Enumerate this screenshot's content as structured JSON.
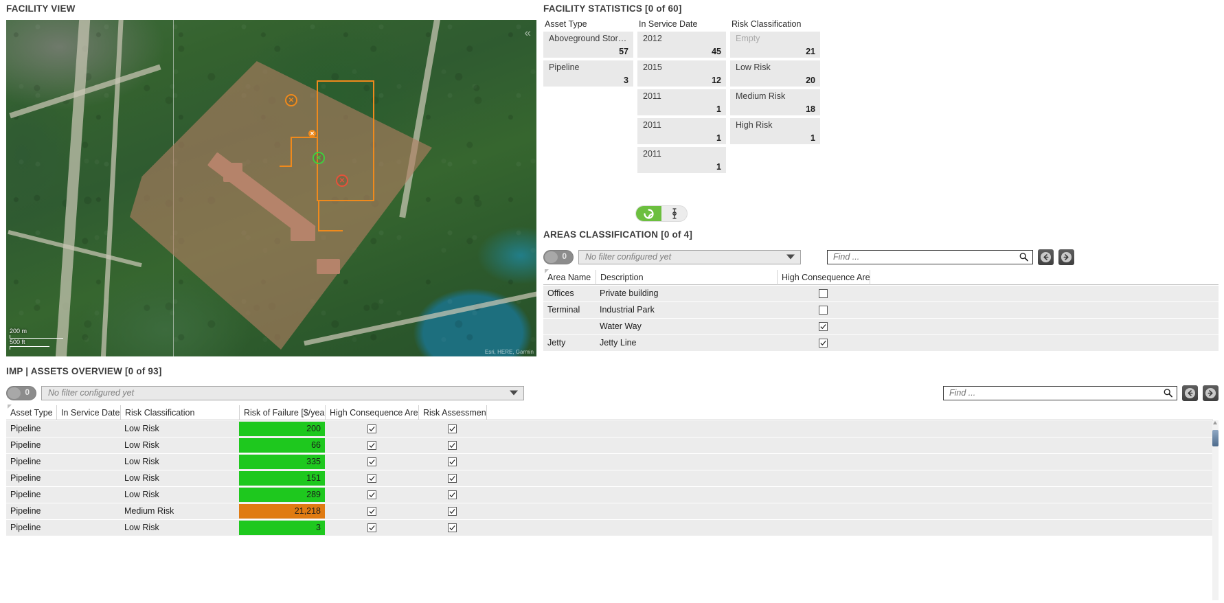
{
  "facility_view": {
    "title": "FACILITY VIEW",
    "collapse_icon": "chevron-left-icon",
    "scale_metric": "200 m",
    "scale_imperial": "500 ft",
    "attribution": "Esri, HERE, Garmin"
  },
  "facility_statistics": {
    "title": "FACILITY STATISTICS [0 of 60]",
    "columns": [
      {
        "header": "Asset Type",
        "cards": [
          {
            "label": "Aboveground Storage...",
            "value": "57",
            "empty": false
          },
          {
            "label": "Pipeline",
            "value": "3",
            "empty": false
          }
        ]
      },
      {
        "header": "In Service Date",
        "cards": [
          {
            "label": "2012",
            "value": "45",
            "empty": false
          },
          {
            "label": "2015",
            "value": "12",
            "empty": false
          },
          {
            "label": "2011",
            "value": "1",
            "empty": false
          },
          {
            "label": "2011",
            "value": "1",
            "empty": false
          },
          {
            "label": "2011",
            "value": "1",
            "empty": false
          }
        ]
      },
      {
        "header": "Risk Classification",
        "cards": [
          {
            "label": "Empty",
            "value": "21",
            "empty": true
          },
          {
            "label": "Low Risk",
            "value": "20",
            "empty": false
          },
          {
            "label": "Medium Risk",
            "value": "18",
            "empty": false
          },
          {
            "label": "High Risk",
            "value": "1",
            "empty": false
          }
        ]
      }
    ],
    "toggle": {
      "left_icon": "refresh-icon",
      "right_icon": "axis-stem-icon",
      "active_color": "#6cbf3f"
    }
  },
  "areas_classification": {
    "title": "AREAS CLASSIFICATION [0 of 4]",
    "toggle_value": "0",
    "filter_placeholder": "No filter configured yet",
    "find_placeholder": "Find ...",
    "find_value": "",
    "nav_back_icon": "arrow-left-circle-icon",
    "nav_forward_icon": "arrow-right-circle-icon",
    "columns": [
      "Area Name",
      "Description",
      "High Consequence Area",
      ""
    ],
    "rows": [
      {
        "area_name": "Offices",
        "description": "Private building",
        "high_consequence_area": false
      },
      {
        "area_name": "Terminal",
        "description": "Industrial Park",
        "high_consequence_area": false
      },
      {
        "area_name": "",
        "description": "Water Way",
        "high_consequence_area": true
      },
      {
        "area_name": "Jetty",
        "description": "Jetty Line",
        "high_consequence_area": true
      }
    ]
  },
  "assets_overview": {
    "title": "IMP | ASSETS OVERVIEW [0 of 93]",
    "toggle_value": "0",
    "filter_placeholder": "No filter configured yet",
    "find_placeholder": "Find ...",
    "find_value": "",
    "nav_back_icon": "arrow-left-circle-icon",
    "nav_forward_icon": "arrow-right-circle-icon",
    "columns": [
      "Asset Type",
      "In Service Date",
      "Risk Classification",
      "Risk of Failure [$/year]",
      "High Consequence Area",
      "Risk Assessment",
      ""
    ],
    "rows": [
      {
        "asset_type": "Pipeline",
        "in_service_date": "",
        "risk_classification": "Low Risk",
        "risk_of_failure": "200",
        "risk_level": "low",
        "high_consequence_area": true,
        "risk_assessment": true
      },
      {
        "asset_type": "Pipeline",
        "in_service_date": "",
        "risk_classification": "Low Risk",
        "risk_of_failure": "66",
        "risk_level": "low",
        "high_consequence_area": true,
        "risk_assessment": true
      },
      {
        "asset_type": "Pipeline",
        "in_service_date": "",
        "risk_classification": "Low Risk",
        "risk_of_failure": "335",
        "risk_level": "low",
        "high_consequence_area": true,
        "risk_assessment": true
      },
      {
        "asset_type": "Pipeline",
        "in_service_date": "",
        "risk_classification": "Low Risk",
        "risk_of_failure": "151",
        "risk_level": "low",
        "high_consequence_area": true,
        "risk_assessment": true
      },
      {
        "asset_type": "Pipeline",
        "in_service_date": "",
        "risk_classification": "Low Risk",
        "risk_of_failure": "289",
        "risk_level": "low",
        "high_consequence_area": true,
        "risk_assessment": true
      },
      {
        "asset_type": "Pipeline",
        "in_service_date": "",
        "risk_classification": "Medium Risk",
        "risk_of_failure": "21,218",
        "risk_level": "medium",
        "high_consequence_area": true,
        "risk_assessment": true
      },
      {
        "asset_type": "Pipeline",
        "in_service_date": "",
        "risk_classification": "Low Risk",
        "risk_of_failure": "3",
        "risk_level": "low",
        "high_consequence_area": true,
        "risk_assessment": true
      }
    ],
    "colors": {
      "low_risk": "#1ec81e",
      "medium_risk": "#e07b12"
    }
  }
}
